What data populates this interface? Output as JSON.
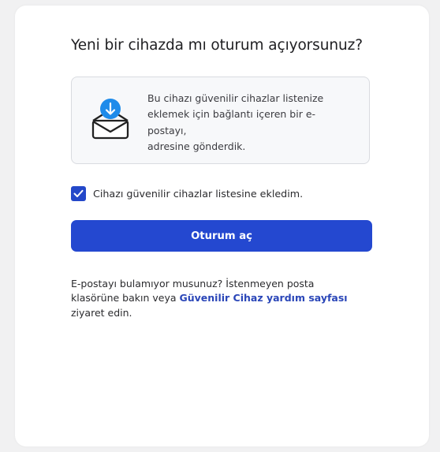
{
  "title": "Yeni bir cihazda mı oturum açıyorsunuz?",
  "info": {
    "icon": "mail-download-icon",
    "lines": [
      "Bu cihazı güvenilir cihazlar listenize",
      "eklemek için bağlantı içeren bir e-",
      "postayı,",
      "adresine gönderdik."
    ]
  },
  "checkbox": {
    "checked": true,
    "label": "Cihazı güvenilir cihazlar listesine ekledim."
  },
  "submit_button": {
    "label": "Oturum aç"
  },
  "help": {
    "line1": "E-postayı bulamıyor musunuz? İstenmeyen posta",
    "line2_prefix": "klasörüne bakın veya ",
    "link_label": "Güvenilir Cihaz yardım sayfası",
    "line3": "ziyaret edin."
  },
  "colors": {
    "accent": "#2448d0",
    "icon_blue": "#1e8bea",
    "link": "#2a46b8",
    "background": "#f1f1f2"
  }
}
